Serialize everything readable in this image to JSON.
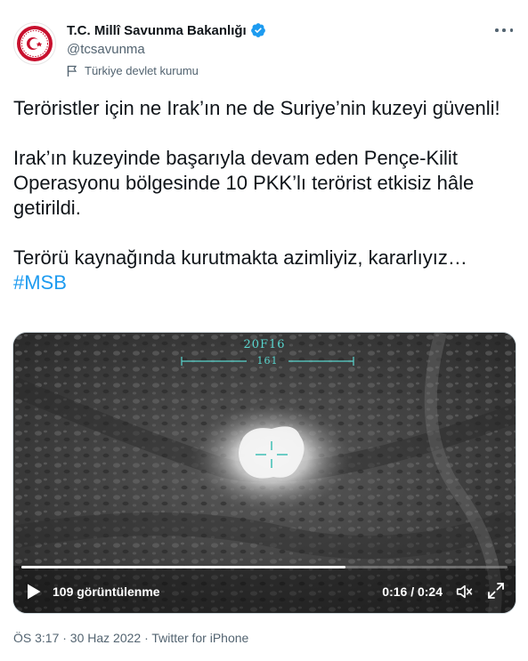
{
  "account": {
    "display_name": "T.C. Millî Savunma Bakanlığı",
    "handle": "@tcsavunma",
    "label": "Türkiye devlet kurumu",
    "avatar_icon": "ministry-seal-icon",
    "verified_icon": "verified-badge-icon",
    "verified_color": "#1d9bf0"
  },
  "tweet": {
    "line1": "Teröristler için ne Irak’ın ne de Suriye’nin kuzeyi güvenli!",
    "line2": "Irak’ın kuzeyinde başarıyla devam eden Pençe-Kilit Operasyonu bölgesinde 10 PKK’lı terörist etkisiz hâle getirildi.",
    "line3": "Terörü kaynağında kurutmakta azimliyiz, kararlıyız…",
    "hashtag": "#MSB",
    "hashtag_color": "#1d9bf0"
  },
  "video": {
    "hud_label": "20F16",
    "hud_value": "161",
    "views_text": "109 görüntülenme",
    "timecode": "0:16 / 0:24",
    "progress": 0.667
  },
  "meta": {
    "footer": "ÖS 3:17 · 30 Haz 2022 · Twitter for iPhone"
  }
}
